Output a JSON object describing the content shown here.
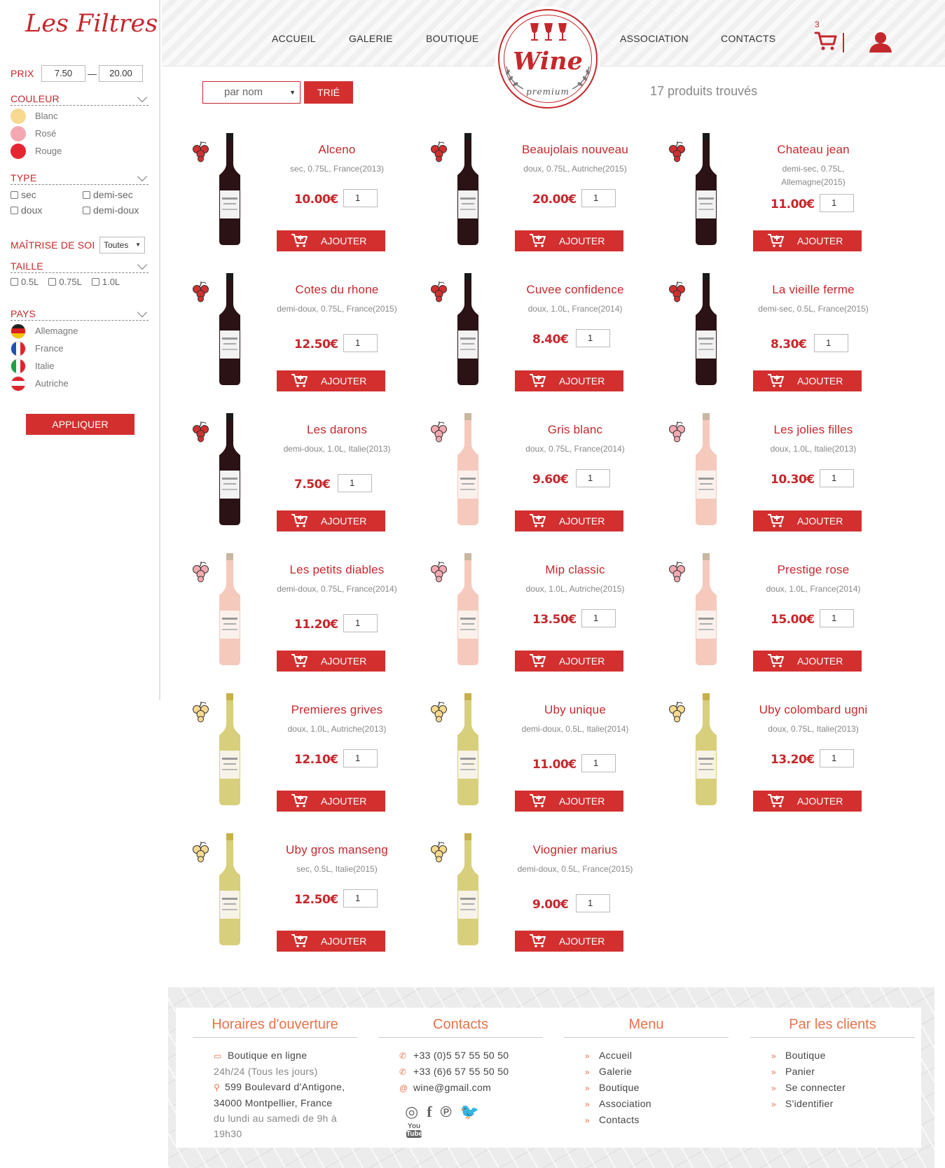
{
  "filters": {
    "title": "Les Filtres",
    "price_label": "PRIX",
    "price_min": "7.50",
    "price_max": "20.00",
    "price_sep": "—",
    "color_label": "COULEUR",
    "colors": [
      {
        "label": "Blanc",
        "swatch": "#f7d98f"
      },
      {
        "label": "Rosé",
        "swatch": "#f4a9b1"
      },
      {
        "label": "Rouge",
        "swatch": "#e52632"
      }
    ],
    "type_label": "TYPE",
    "types": [
      "sec",
      "demi-sec",
      "doux",
      "demi-doux"
    ],
    "mastery_label": "MAÎTRISE DE SOI",
    "mastery_value": "Toutes",
    "size_label": "TAILLE",
    "sizes": [
      "0.5L",
      "0.75L",
      "1.0L"
    ],
    "country_label": "PAYS",
    "countries": [
      "Allemagne",
      "France",
      "Italie",
      "Autriche"
    ],
    "apply_label": "APPLIQUER"
  },
  "header": {
    "nav": [
      "ACCUEIL",
      "GALERIE",
      "BOUTIQUE",
      "ASSOCIATION",
      "CONTACTS"
    ],
    "logo_word": "Wine",
    "logo_sub": "premium",
    "cart_count": "3"
  },
  "sort": {
    "select_value": "par nom",
    "button_label": "TRIÉ",
    "found": "17 produits trouvés"
  },
  "add_label": "AJOUTER",
  "products": [
    {
      "name": "Alceno",
      "desc": "sec, 0.75L, France(2013)",
      "price": "10.00€",
      "qty": "1",
      "kind": "rouge"
    },
    {
      "name": "Beaujolais nouveau",
      "desc": "doux, 0.75L, Autriche(2015)",
      "price": "20.00€",
      "qty": "1",
      "kind": "rouge"
    },
    {
      "name": "Chateau jean",
      "desc": "demi-sec, 0.75L, Allemagne(2015)",
      "price": "11.00€",
      "qty": "1",
      "kind": "rouge"
    },
    {
      "name": "Cotes du rhone",
      "desc": "demi-doux, 0.75L, France(2015)",
      "price": "12.50€",
      "qty": "1",
      "kind": "rouge"
    },
    {
      "name": "Cuvee confidence",
      "desc": "doux, 1.0L, France(2014)",
      "price": "8.40€",
      "qty": "1",
      "kind": "rouge"
    },
    {
      "name": "La vieille ferme",
      "desc": "demi-sec, 0.5L, France(2015)",
      "price": "8.30€",
      "qty": "1",
      "kind": "rouge"
    },
    {
      "name": "Les darons",
      "desc": "demi-doux, 1.0L, Italie(2013)",
      "price": "7.50€",
      "qty": "1",
      "kind": "rouge"
    },
    {
      "name": "Gris blanc",
      "desc": "doux, 0.75L, France(2014)",
      "price": "9.60€",
      "qty": "1",
      "kind": "rose"
    },
    {
      "name": "Les jolies filles",
      "desc": "doux, 1.0L, Italie(2013)",
      "price": "10.30€",
      "qty": "1",
      "kind": "rose"
    },
    {
      "name": "Les petits diables",
      "desc": "demi-doux, 0.75L, France(2014)",
      "price": "11.20€",
      "qty": "1",
      "kind": "rose"
    },
    {
      "name": "Mip classic",
      "desc": "doux, 1.0L, Autriche(2015)",
      "price": "13.50€",
      "qty": "1",
      "kind": "rose"
    },
    {
      "name": "Prestige rose",
      "desc": "doux, 1.0L, France(2014)",
      "price": "15.00€",
      "qty": "1",
      "kind": "rose"
    },
    {
      "name": "Premieres grives",
      "desc": "doux, 1.0L, Autriche(2013)",
      "price": "12.10€",
      "qty": "1",
      "kind": "blanc"
    },
    {
      "name": "Uby unique",
      "desc": "demi-doux, 0.5L, Italie(2014)",
      "price": "11.00€",
      "qty": "1",
      "kind": "blanc"
    },
    {
      "name": "Uby colombard ugni",
      "desc": "doux, 0.75L, Italie(2013)",
      "price": "13.20€",
      "qty": "1",
      "kind": "blanc"
    },
    {
      "name": "Uby gros manseng",
      "desc": "sec, 0.5L, Italie(2015)",
      "price": "12.50€",
      "qty": "1",
      "kind": "blanc"
    },
    {
      "name": "Viognier marius",
      "desc": "demi-doux, 0.5L, France(2015)",
      "price": "9.00€",
      "qty": "1",
      "kind": "blanc"
    }
  ],
  "footer": {
    "hours_title": "Horaires d'ouverture",
    "hours_line1": "Boutique en ligne",
    "hours_line2": "24h/24 (Tous les jours)",
    "address_line1": "599 Boulevard d'Antigone,",
    "address_line2": "34000 Montpellier, France",
    "days_line1": "du lundi au samedi de 9h à",
    "days_line2": "19h30",
    "contacts_title": "Contacts",
    "phone1": "+33 (0)5 57 55 50 50",
    "phone2": "+33 (6)6 57 55 50 50",
    "email": "wine@gmail.com",
    "menu_title": "Menu",
    "menu_items": [
      "Accueil",
      "Galerie",
      "Boutique",
      "Association",
      "Contacts"
    ],
    "clients_title": "Par les clients",
    "clients_items": [
      "Boutique",
      "Panier",
      "Se connecter",
      "S'identifier"
    ],
    "youtube_you": "You",
    "youtube_tube": "Tube"
  },
  "theme": {
    "accent": "#d32f2f",
    "brand": "#c5282c",
    "footer_accent": "#e8734a"
  }
}
